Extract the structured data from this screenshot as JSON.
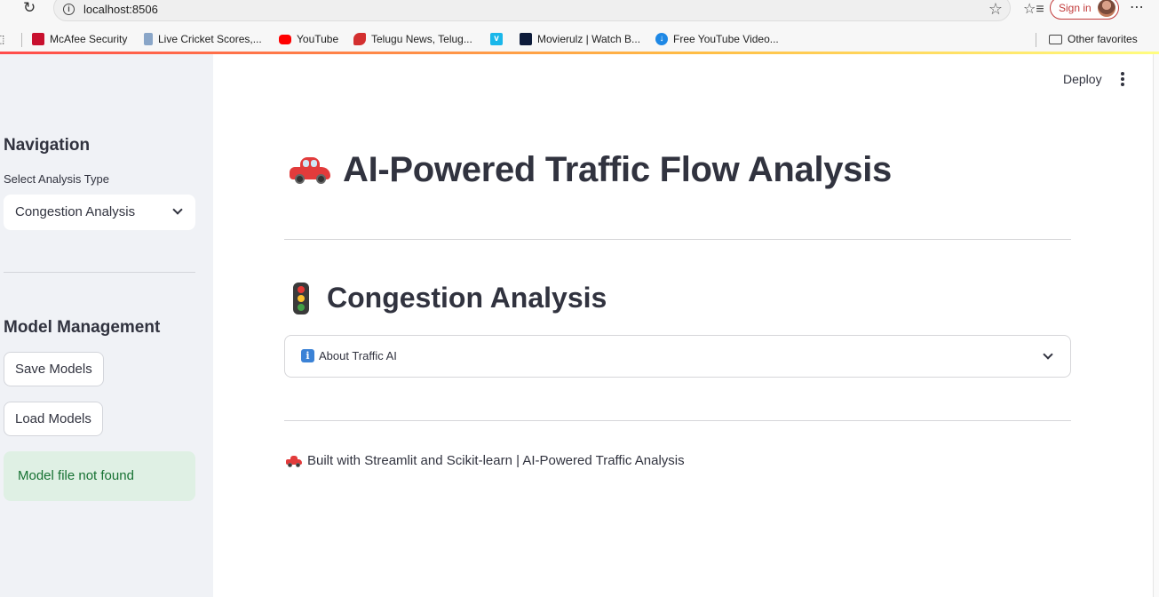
{
  "browser": {
    "url": "localhost:8506",
    "signin_label": "Sign in",
    "bookmarks": [
      {
        "label": "McAfee Security",
        "icon": "mcafee-icon",
        "color": "#c8102e"
      },
      {
        "label": "Live Cricket Scores,...",
        "icon": "cricket-icon",
        "color": "#1f5fa8"
      },
      {
        "label": "YouTube",
        "icon": "youtube-icon",
        "color": "#ff0000"
      },
      {
        "label": "Telugu News, Telug...",
        "icon": "news-icon",
        "color": "#d32f2f"
      },
      {
        "label": "",
        "icon": "vimeo-icon",
        "color": "#1ab7ea"
      },
      {
        "label": "Movierulz | Watch B...",
        "icon": "movierulz-icon",
        "color": "#0d1b3a"
      },
      {
        "label": "Free YouTube Video...",
        "icon": "download-icon",
        "color": "#1e88e5"
      }
    ],
    "other_favorites": "Other favorites"
  },
  "sidebar": {
    "nav_heading": "Navigation",
    "select_label": "Select Analysis Type",
    "select_value": "Congestion Analysis",
    "model_heading": "Model Management",
    "save_button": "Save Models",
    "load_button": "Load Models",
    "alert_text": "Model file not found"
  },
  "header": {
    "deploy_label": "Deploy"
  },
  "main": {
    "title": "AI-Powered Traffic Flow Analysis",
    "subheader": "Congestion Analysis",
    "expander_label": "About Traffic AI",
    "footer": "Built with Streamlit and Scikit-learn | AI-Powered Traffic Analysis"
  },
  "colors": {
    "accent": "#ff4b4b",
    "sidebar_bg": "#f0f2f6",
    "success_bg": "#dff0e4",
    "success_text": "#177233",
    "text": "#31333f"
  }
}
